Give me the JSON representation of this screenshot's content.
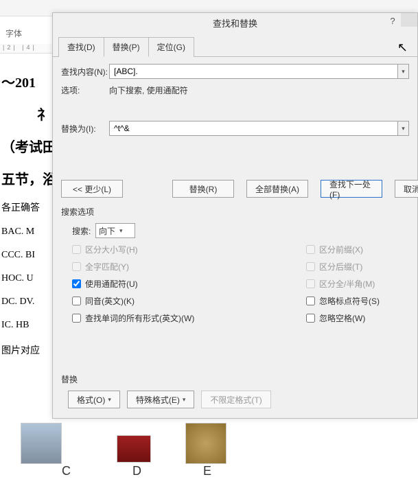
{
  "ribbon": {
    "group_label": "字体",
    "ruler_text": "|2|  |4|"
  },
  "doc": {
    "t1": "～201",
    "t2": "礻",
    "t3": "（考试田",
    "t4": "五节，浴",
    "t5": "各正确答",
    "l1": "BAC. M",
    "l2": "CCC. BI",
    "l3": "HOC. U",
    "l4": "DC. DV.",
    "l5": "IC. HB",
    "t6": "图片对应",
    "labC": "C",
    "labD": "D",
    "labE": "E"
  },
  "dialog": {
    "title": "查找和替换",
    "help": "?",
    "tabs": {
      "find": "查找(D)",
      "replace": "替换(P)",
      "goto": "定位(G)"
    },
    "find_label": "查找内容(N):",
    "find_value": "[ABC].",
    "options_label": "选项:",
    "options_value": "向下搜索, 使用通配符",
    "replace_label": "替换为(I):",
    "replace_value": "^t^&",
    "less_btn": "<< 更少(L)",
    "replace_btn": "替换(R)",
    "replace_all_btn": "全部替换(A)",
    "find_next_btn": "查找下一处(F)",
    "cancel_btn": "取消",
    "search_options_label": "搜索选项",
    "search_label": "搜索:",
    "search_direction": "向下",
    "cb_match_case": "区分大小写(H)",
    "cb_whole_word": "全字匹配(Y)",
    "cb_wildcards": "使用通配符(U)",
    "cb_sounds_like": "同音(英文)(K)",
    "cb_word_forms": "查找单词的所有形式(英文)(W)",
    "cb_prefix": "区分前缀(X)",
    "cb_suffix": "区分后缀(T)",
    "cb_fullwidth": "区分全/半角(M)",
    "cb_punct": "忽略标点符号(S)",
    "cb_space": "忽略空格(W)",
    "replace_section": "替换",
    "format_btn": "格式(O)",
    "special_btn": "特殊格式(E)",
    "noformat_btn": "不限定格式(T)"
  }
}
